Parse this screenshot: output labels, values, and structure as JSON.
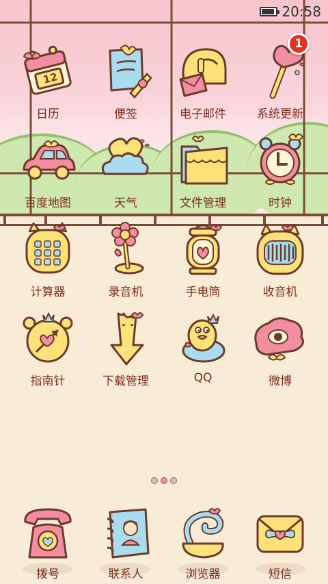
{
  "status_bar": {
    "time": "20:58",
    "battery_level": 0.9,
    "battery_icon": "battery-icon"
  },
  "apps": [
    {
      "id": "calendar",
      "label": "日历",
      "icon": "calendar-icon"
    },
    {
      "id": "notes",
      "label": "便签",
      "icon": "notes-icon"
    },
    {
      "id": "email",
      "label": "电子邮件",
      "icon": "email-icon"
    },
    {
      "id": "system-update",
      "label": "系统更新",
      "icon": "heart-wand-icon",
      "badge": "1"
    },
    {
      "id": "baidu-map",
      "label": "百度地图",
      "icon": "car-icon"
    },
    {
      "id": "weather",
      "label": "天气",
      "icon": "cloud-heart-icon"
    },
    {
      "id": "file-manager",
      "label": "文件管理",
      "icon": "folder-icon"
    },
    {
      "id": "clock",
      "label": "时钟",
      "icon": "alarm-clock-icon"
    },
    {
      "id": "calculator",
      "label": "计算器",
      "icon": "calculator-icon"
    },
    {
      "id": "recorder",
      "label": "录音机",
      "icon": "flower-microphone-icon"
    },
    {
      "id": "flashlight",
      "label": "手电筒",
      "icon": "lantern-icon"
    },
    {
      "id": "radio",
      "label": "收音机",
      "icon": "radio-icon"
    },
    {
      "id": "compass",
      "label": "指南针",
      "icon": "compass-icon"
    },
    {
      "id": "download-manager",
      "label": "下载管理",
      "icon": "download-arrow-icon"
    },
    {
      "id": "qq",
      "label": "QQ",
      "icon": "penguin-icon"
    },
    {
      "id": "weibo",
      "label": "微博",
      "icon": "eye-cloud-icon"
    }
  ],
  "dock": [
    {
      "id": "dialer",
      "label": "拨号",
      "icon": "telephone-icon"
    },
    {
      "id": "contacts",
      "label": "联系人",
      "icon": "contacts-book-icon"
    },
    {
      "id": "browser",
      "label": "浏览器",
      "icon": "globe-swirl-icon"
    },
    {
      "id": "sms",
      "label": "短信",
      "icon": "envelope-icon"
    }
  ],
  "page_indicator": {
    "pages": 3,
    "current": 2
  },
  "colors": {
    "label": "#7b2c1e",
    "frame": "#7b4b3a",
    "badge": "#e53321",
    "background": "#f8ecd7"
  }
}
